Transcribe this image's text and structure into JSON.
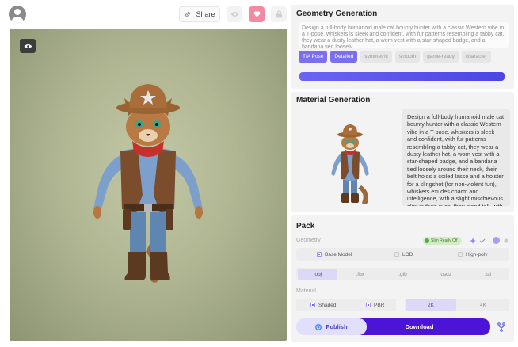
{
  "topbar": {
    "share_label": "Share"
  },
  "geometry": {
    "title": "Geometry Generation",
    "prompt": "Design a full-body humanoid male cat bounty hunter with a classic Western vibe in a T-pose. whiskers is sleek and confident, with fur patterns resembling a tabby cat, they wear a dusty leather hat, a worn vest with a star-shaped badge, and a bandana tied loosely",
    "tags": [
      {
        "label": "T/A Pose",
        "active": true
      },
      {
        "label": "Detailed",
        "active": true
      },
      {
        "label": "symmetric",
        "active": false
      },
      {
        "label": "smooth",
        "active": false
      },
      {
        "label": "game-ready",
        "active": false
      },
      {
        "label": "character",
        "active": false
      }
    ],
    "progress": 1.0
  },
  "material": {
    "title": "Material Generation",
    "description": "Design a full-body humanoid male cat bounty hunter with a classic Western vibe in a T-pose. whiskers is sleek and confident, with fur patterns resembling a tabby cat, they wear a dusty leather hat, a worn vest with a star-shaped badge, and a bandana tied loosely around their neck, their belt holds a coiled lasso and a holster for a slingshot (for non-violent fun), whiskers exudes charm and intelligence, with a slight mischievous glint in their eyes. they stand tall, with one leg slightly bent"
  },
  "pack": {
    "title": "Pack",
    "geometry_label": "Geometry",
    "slim_badge": "Slim Ready Off",
    "options": {
      "base_model": "Base Model",
      "lod": "LOD",
      "high_poly": "High-poly"
    },
    "formats": [
      {
        "label": ".obj",
        "active": true
      },
      {
        "label": ".fbx",
        "active": false
      },
      {
        "label": ".glb",
        "active": false
      },
      {
        "label": ".usdz",
        "active": false
      },
      {
        "label": ".stl",
        "active": false
      }
    ],
    "material_label": "Material",
    "shaded": "Shaded",
    "pbr": "PBR",
    "resolutions": [
      {
        "label": "2K",
        "active": true
      },
      {
        "label": "4K",
        "active": false
      }
    ],
    "publish_label": "Publish",
    "download_label": "Download"
  },
  "colors": {
    "accent": "#4b14d8",
    "progress": "#5a52ea",
    "heart": "#f28aa3"
  }
}
